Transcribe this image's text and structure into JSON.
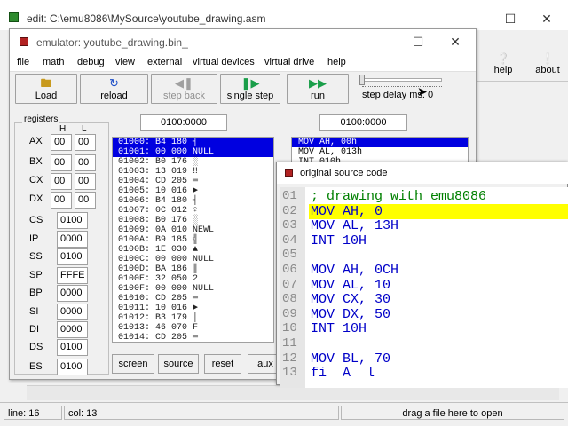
{
  "editor": {
    "title": "edit: C:\\emu8086\\MySource\\youtube_drawing.asm",
    "toolbar": [
      {
        "label": "help",
        "icon": "question-icon"
      },
      {
        "label": "about",
        "icon": "info-icon"
      }
    ]
  },
  "emulator": {
    "title": "emulator: youtube_drawing.bin_",
    "menu": [
      "file",
      "math",
      "debug",
      "view",
      "external",
      "virtual devices",
      "virtual drive",
      "help"
    ],
    "buttons": {
      "load": "Load",
      "reload": "reload",
      "step_back": "step back",
      "single_step": "single step",
      "run": "run"
    },
    "step_delay_label": "step delay ms: 0",
    "step_delay_value": 0,
    "address_left": "0100:0000",
    "address_right": "0100:0000",
    "registers": {
      "label": "registers",
      "h_label": "H",
      "l_label": "L",
      "split": [
        {
          "name": "AX",
          "h": "00",
          "l": "00"
        },
        {
          "name": "BX",
          "h": "00",
          "l": "00"
        },
        {
          "name": "CX",
          "h": "00",
          "l": "00"
        },
        {
          "name": "DX",
          "h": "00",
          "l": "00"
        }
      ],
      "full": [
        {
          "name": "CS",
          "value": "0100"
        },
        {
          "name": "IP",
          "value": "0000"
        },
        {
          "name": "SS",
          "value": "0100"
        },
        {
          "name": "SP",
          "value": "FFFE"
        },
        {
          "name": "BP",
          "value": "0000"
        },
        {
          "name": "SI",
          "value": "0000"
        },
        {
          "name": "DI",
          "value": "0000"
        },
        {
          "name": "DS",
          "value": "0100"
        },
        {
          "name": "ES",
          "value": "0100"
        }
      ]
    },
    "disassembly": [
      {
        "text": "01000: B4 180 ┤",
        "selected": true
      },
      {
        "text": "01001: 00 000 NULL",
        "selected": true
      },
      {
        "text": "01002: B0 176 ░",
        "selected": false
      },
      {
        "text": "01003: 13 019 ‼",
        "selected": false
      },
      {
        "text": "01004: CD 205 ═",
        "selected": false
      },
      {
        "text": "01005: 10 016 ►",
        "selected": false
      },
      {
        "text": "01006: B4 180 ┤",
        "selected": false
      },
      {
        "text": "01007: 0C 012 ♀",
        "selected": false
      },
      {
        "text": "01008: B0 176 ░",
        "selected": false
      },
      {
        "text": "01009: 0A 010 NEWL",
        "selected": false
      },
      {
        "text": "0100A: B9 185 ╣",
        "selected": false
      },
      {
        "text": "0100B: 1E 030 ▲",
        "selected": false
      },
      {
        "text": "0100C: 00 000 NULL",
        "selected": false
      },
      {
        "text": "0100D: BA 186 ║",
        "selected": false
      },
      {
        "text": "0100E: 32 050 2",
        "selected": false
      },
      {
        "text": "0100F: 00 000 NULL",
        "selected": false
      },
      {
        "text": "01010: CD 205 ═",
        "selected": false
      },
      {
        "text": "01011: 10 016 ►",
        "selected": false
      },
      {
        "text": "01012: B3 179 │",
        "selected": false
      },
      {
        "text": "01013: 46 070 F",
        "selected": false
      },
      {
        "text": "01014: CD 205 ═",
        "selected": false
      }
    ],
    "decoded": [
      {
        "text": "MOV AH, 00h",
        "selected": true
      },
      {
        "text": "MOV AL, 013h",
        "selected": false
      },
      {
        "text": "INT 010h",
        "selected": false
      }
    ],
    "bottom_buttons": [
      "screen",
      "source",
      "reset",
      "aux"
    ]
  },
  "source_window": {
    "title": "original source code",
    "lines": [
      {
        "num": "01",
        "code": "; drawing with emu8086",
        "kind": "comment",
        "highlight": false
      },
      {
        "num": "02",
        "code": "MOV AH, 0",
        "kind": "code",
        "highlight": true
      },
      {
        "num": "03",
        "code": "MOV AL, 13H",
        "kind": "code",
        "highlight": false
      },
      {
        "num": "04",
        "code": "INT 10H",
        "kind": "code",
        "highlight": false
      },
      {
        "num": "05",
        "code": "",
        "kind": "code",
        "highlight": false
      },
      {
        "num": "06",
        "code": "MOV AH, 0CH",
        "kind": "code",
        "highlight": false
      },
      {
        "num": "07",
        "code": "MOV AL, 10",
        "kind": "code",
        "highlight": false
      },
      {
        "num": "08",
        "code": "MOV CX, 30",
        "kind": "code",
        "highlight": false
      },
      {
        "num": "09",
        "code": "MOV DX, 50",
        "kind": "code",
        "highlight": false
      },
      {
        "num": "10",
        "code": "INT 10H",
        "kind": "code",
        "highlight": false
      },
      {
        "num": "11",
        "code": "",
        "kind": "code",
        "highlight": false
      },
      {
        "num": "12",
        "code": "MOV BL, 70",
        "kind": "code",
        "highlight": false
      },
      {
        "num": "13",
        "code": "fi  A  l",
        "kind": "code",
        "highlight": false
      }
    ]
  },
  "status": {
    "line": "line: 16",
    "col": "col: 13",
    "hint": "drag a file here to open"
  }
}
